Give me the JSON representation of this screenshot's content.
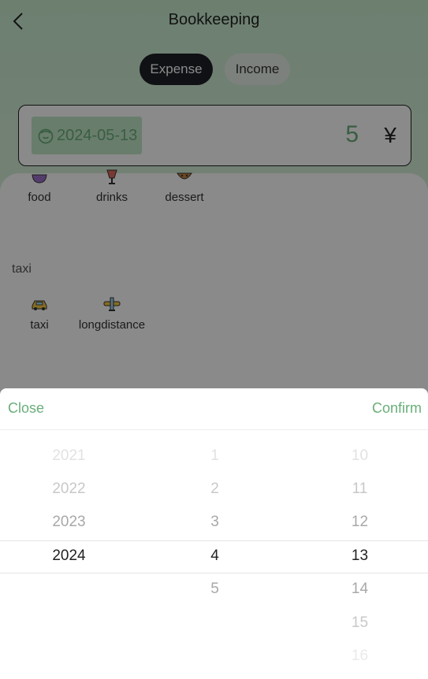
{
  "header": {
    "title": "Bookkeeping",
    "back_icon": "chevron-left-icon"
  },
  "tabs": {
    "expense": "Expense",
    "income": "Income",
    "active": "Expense"
  },
  "entry": {
    "calendar_icon": "calendar-icon",
    "date": "2024-05-13",
    "amount": "5",
    "currency": "¥"
  },
  "categories": {
    "top_row": [
      {
        "label": "food",
        "icon": "bowl-icon"
      },
      {
        "label": "drinks",
        "icon": "cup-icon"
      },
      {
        "label": "dessert",
        "icon": "cake-icon"
      }
    ],
    "groups": [
      {
        "title": "taxi",
        "items": [
          {
            "label": "taxi",
            "icon": "car-icon"
          },
          {
            "label": "longdistance",
            "icon": "airplane-icon"
          }
        ]
      }
    ]
  },
  "date_picker": {
    "close": "Close",
    "confirm": "Confirm",
    "years": [
      "2021",
      "2022",
      "2023",
      "2024"
    ],
    "selected_year": "2024",
    "months": [
      "1",
      "2",
      "3",
      "4",
      "5"
    ],
    "selected_month": "4",
    "days": [
      "10",
      "11",
      "12",
      "13",
      "14",
      "15",
      "16"
    ],
    "selected_day": "13"
  },
  "colors": {
    "accent_green": "#6aae7a",
    "dark_button": "#1f2025",
    "background_green": "#c9ecd0"
  }
}
